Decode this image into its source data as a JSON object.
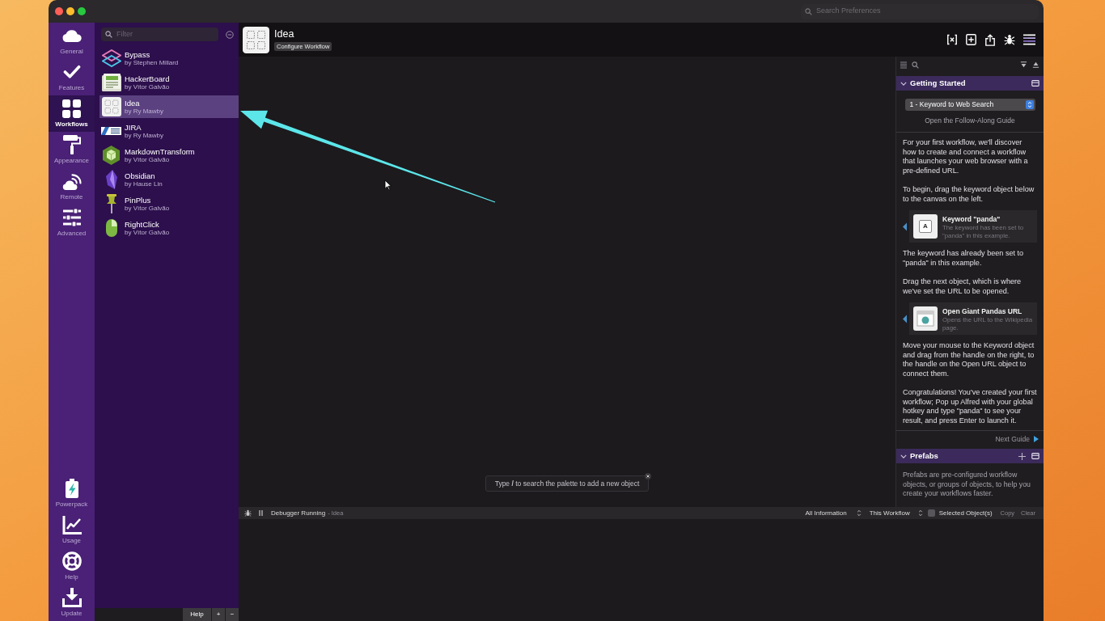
{
  "window": {
    "search_placeholder": "Search Preferences"
  },
  "sidebar": {
    "items": [
      {
        "label": "General",
        "selected": false
      },
      {
        "label": "Features",
        "selected": false
      },
      {
        "label": "Workflows",
        "selected": true
      },
      {
        "label": "Appearance",
        "selected": false
      },
      {
        "label": "Remote",
        "selected": false
      },
      {
        "label": "Advanced",
        "selected": false
      }
    ],
    "bottom_items": [
      {
        "label": "Powerpack"
      },
      {
        "label": "Usage"
      },
      {
        "label": "Help"
      },
      {
        "label": "Update"
      }
    ]
  },
  "workflow_list": {
    "filter_placeholder": "Filter",
    "items": [
      {
        "name": "Bypass",
        "author": "by Stephen Millard",
        "selected": false
      },
      {
        "name": "HackerBoard",
        "author": "by Vítor Galvão",
        "selected": false
      },
      {
        "name": "Idea",
        "author": "by Ry Mawby",
        "selected": true
      },
      {
        "name": "JIRA",
        "author": "by Ry Mawby",
        "selected": false
      },
      {
        "name": "MarkdownTransform",
        "author": "by Vítor Galvão",
        "selected": false
      },
      {
        "name": "Obsidian",
        "author": "by Hause Lin",
        "selected": false
      },
      {
        "name": "PinPlus",
        "author": "by Vítor Galvão",
        "selected": false
      },
      {
        "name": "RightClick",
        "author": "by Vítor Galvão",
        "selected": false
      }
    ],
    "buttons": [
      "Help",
      "+",
      "−"
    ]
  },
  "editor": {
    "title": "Idea",
    "badge": "Configure Workflow",
    "canvas_hint": "Type **/** to search the palette to add a new object"
  },
  "getting_started": {
    "title": "Getting Started",
    "expanded": true,
    "guide": "1 - Keyword to Web Search",
    "guide_link": "Open the Follow-Along Guide",
    "content": [
      {
        "kind": "paragraph",
        "text": "For your first workflow, we'll discover how to create and connect a workflow that launches your web browser with a pre-defined URL."
      },
      {
        "kind": "paragraph",
        "text": "To begin, drag the keyword object below to the canvas on the left."
      },
      {
        "kind": "object",
        "title": "Keyword \"panda\"",
        "description": "The keyword has been set to \"panda\" in this example.",
        "key_label": "A"
      },
      {
        "kind": "paragraph",
        "text": "The keyword has already been set to \"panda\" in this example."
      },
      {
        "kind": "paragraph",
        "text": "Drag the next object, which is where we've set the URL to be opened."
      },
      {
        "kind": "object",
        "title": "Open Giant Pandas URL",
        "description": "Opens the URL to the Wikipedia page."
      },
      {
        "kind": "paragraph",
        "text": "Move your mouse to the Keyword object and drag from the handle on the right, to the handle on the Open URL object to connect them."
      },
      {
        "kind": "paragraph",
        "text": "Congratulations! You've created your first workflow; Pop up Alfred with your global hotkey and type \"panda\" to see your result, and press Enter to launch it."
      }
    ],
    "next_guide": "Next Guide"
  },
  "prefabs": {
    "title": "Prefabs",
    "expanded": true,
    "text": "Prefabs are pre-configured workflow objects, or groups of objects, to help you create your workflows faster."
  },
  "debugger": {
    "status": "Debugger Running",
    "workflow": "- Idea",
    "filter": "All Information",
    "scope": "This Workflow",
    "selected_objects": {
      "label": "Selected Object(s)",
      "checked": false
    },
    "actions": [
      "Copy",
      "Clear"
    ]
  }
}
